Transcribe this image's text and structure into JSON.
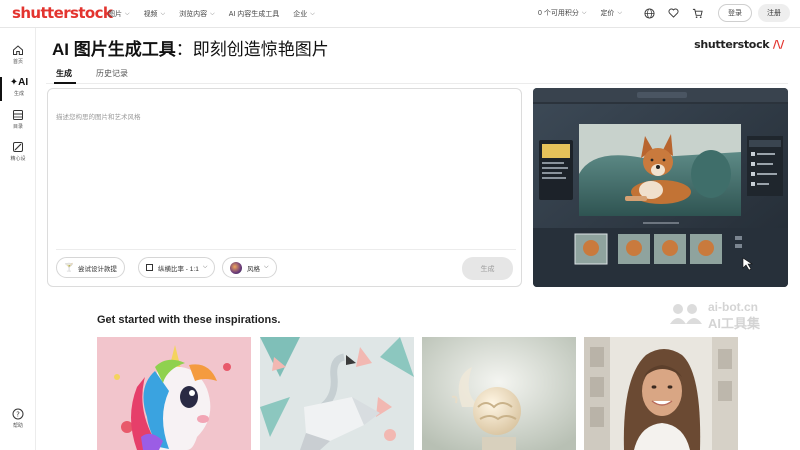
{
  "brand": {
    "logo_text": "shutterstock",
    "accent": "#e3342f"
  },
  "topnav": {
    "links": [
      {
        "label": "图片"
      },
      {
        "label": "视频"
      },
      {
        "label": "浏览内容"
      },
      {
        "label": "AI 内容生成工具"
      },
      {
        "label": "企业"
      }
    ],
    "credits": "0 个可用积分",
    "pricing": "定价",
    "login": "登录",
    "signup": "注册",
    "icons": [
      "globe-icon",
      "heart-icon",
      "cart-icon"
    ]
  },
  "sidebar": {
    "items": [
      {
        "label": "首页",
        "icon": "home-icon"
      },
      {
        "label": "生成",
        "icon": "ai-generate-icon",
        "active": true
      },
      {
        "label": "目录",
        "icon": "catalog-icon"
      },
      {
        "label": "精心设",
        "icon": "design-icon"
      },
      {
        "label": "帮助",
        "icon": "help-icon"
      }
    ]
  },
  "page": {
    "title_bold": "AI 图片生成工具",
    "title_rest": "：即刻创造惊艳图片",
    "brand_right": "shutterstock",
    "tabs": [
      {
        "label": "生成",
        "active": true
      },
      {
        "label": "历史记录",
        "active": false
      }
    ]
  },
  "prompt": {
    "placeholder": "描述您构思的图片和艺术风格",
    "design_hint_label": "尝试设计款提",
    "aspect_ratio_label": "纵横比率 - 1:1",
    "style_label": "风格",
    "generate_label": "生成"
  },
  "inspirations": {
    "title": "Get started with these inspirations.",
    "items": [
      "unicorn",
      "paper-flamingo",
      "ice-cream-scoop",
      "smiling-woman"
    ]
  },
  "watermark": {
    "line1": "ai-bot.cn",
    "line2": "AI工具集"
  }
}
